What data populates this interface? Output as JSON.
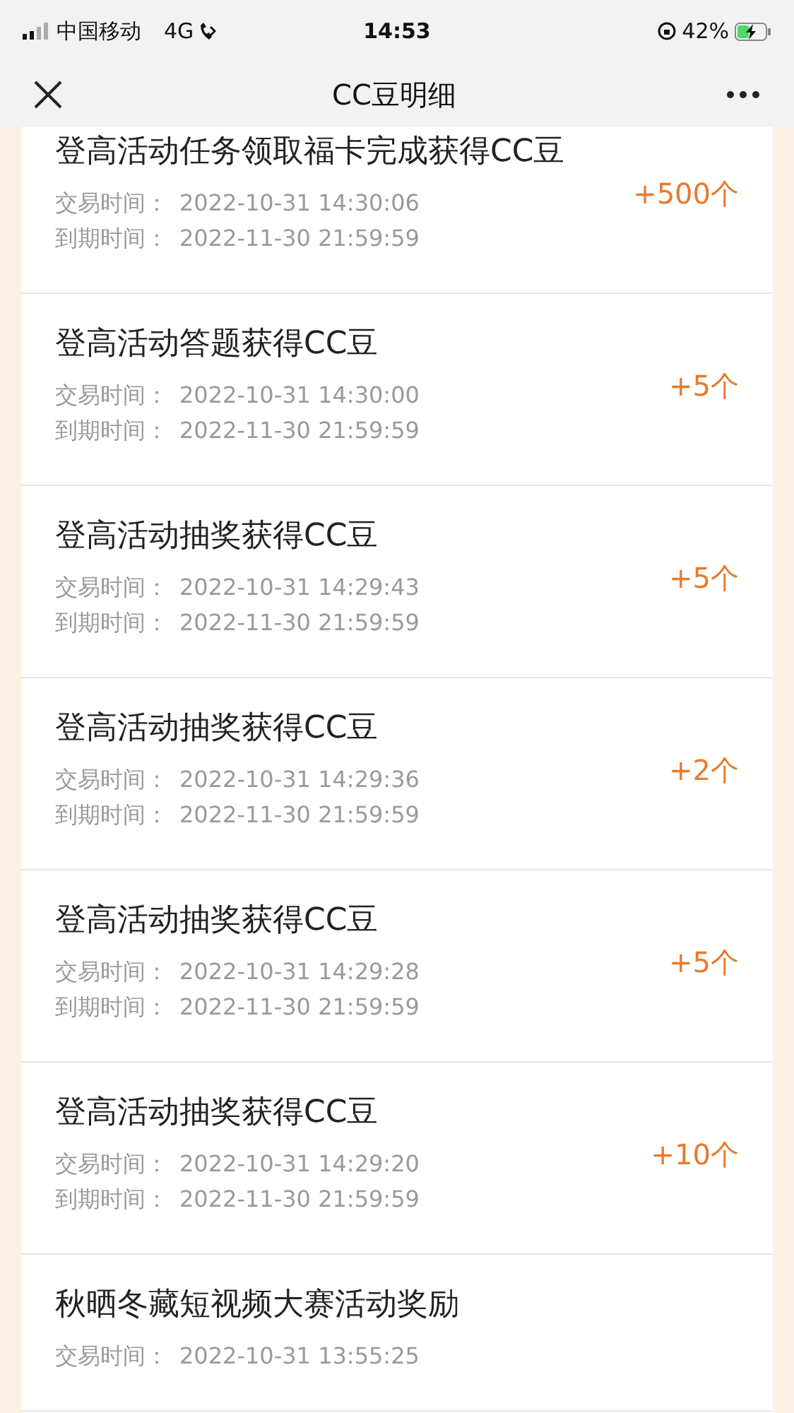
{
  "status_bar": {
    "carrier": "中国移动",
    "network": "4G",
    "time": "14:53",
    "battery": "42%",
    "charging": true
  },
  "nav": {
    "title": "CC豆明细"
  },
  "records": [
    {
      "title": "登高活动任务领取福卡完成获得CC豆",
      "trade_label": "交易时间：",
      "trade_time": "2022-10-31 14:30:06",
      "expire_label": "到期时间：",
      "expire_time": "2022-11-30 21:59:59",
      "amount": "+500个"
    },
    {
      "title": "登高活动答题获得CC豆",
      "trade_label": "交易时间：",
      "trade_time": "2022-10-31 14:30:00",
      "expire_label": "到期时间：",
      "expire_time": "2022-11-30 21:59:59",
      "amount": "+5个"
    },
    {
      "title": "登高活动抽奖获得CC豆",
      "trade_label": "交易时间：",
      "trade_time": "2022-10-31 14:29:43",
      "expire_label": "到期时间：",
      "expire_time": "2022-11-30 21:59:59",
      "amount": "+5个"
    },
    {
      "title": "登高活动抽奖获得CC豆",
      "trade_label": "交易时间：",
      "trade_time": "2022-10-31 14:29:36",
      "expire_label": "到期时间：",
      "expire_time": "2022-11-30 21:59:59",
      "amount": "+2个"
    },
    {
      "title": "登高活动抽奖获得CC豆",
      "trade_label": "交易时间：",
      "trade_time": "2022-10-31 14:29:28",
      "expire_label": "到期时间：",
      "expire_time": "2022-11-30 21:59:59",
      "amount": "+5个"
    },
    {
      "title": "登高活动抽奖获得CC豆",
      "trade_label": "交易时间：",
      "trade_time": "2022-10-31 14:29:20",
      "expire_label": "到期时间：",
      "expire_time": "2022-11-30 21:59:59",
      "amount": "+10个"
    },
    {
      "title": "秋晒冬藏短视频大赛活动奖励",
      "trade_label": "交易时间：",
      "trade_time": "2022-10-31 13:55:25"
    }
  ]
}
